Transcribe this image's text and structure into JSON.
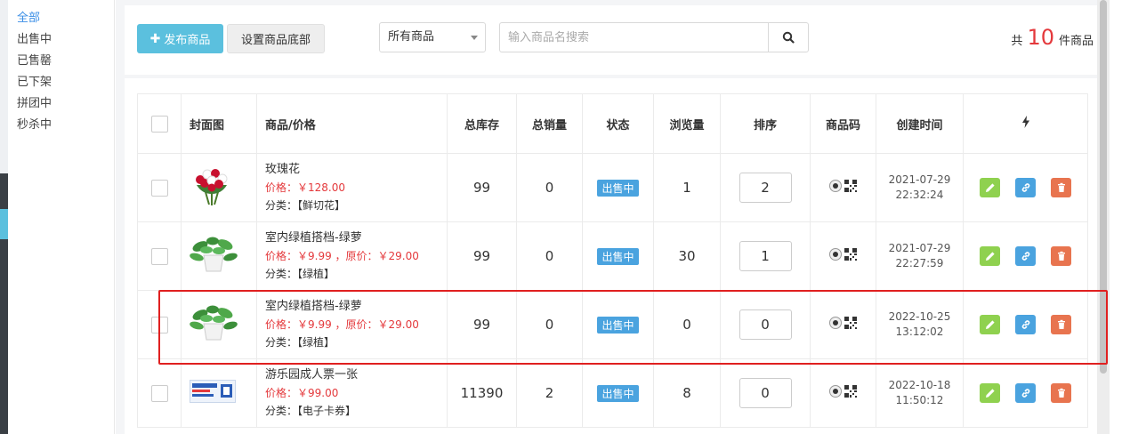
{
  "subnav": [
    "全部",
    "出售中",
    "已售罄",
    "已下架",
    "拼团中",
    "秒杀中"
  ],
  "toolbar": {
    "publish_label": "发布商品",
    "footer_label": "设置商品底部",
    "select_value": "所有商品",
    "search_placeholder": "输入商品名搜索",
    "total_prefix": "共",
    "total_count": "10",
    "total_suffix": "件商品"
  },
  "table": {
    "headers": [
      "封面图",
      "商品/价格",
      "总库存",
      "总销量",
      "状态",
      "浏览量",
      "排序",
      "商品码",
      "创建时间"
    ],
    "rows": [
      {
        "name": "玫瑰花",
        "price": "价格：￥128.00",
        "category": "分类：【鲜切花】",
        "stock": "99",
        "sales": "0",
        "status": "出售中",
        "views": "1",
        "sort": "2",
        "created_date": "2021-07-29",
        "created_time": "22:32:24",
        "thumb": "rose-bouquet"
      },
      {
        "name": "室内绿植搭档-绿萝",
        "price": "价格：￥9.99 ，原价：￥29.00",
        "category": "分类：【绿植】",
        "stock": "99",
        "sales": "0",
        "status": "出售中",
        "views": "30",
        "sort": "1",
        "created_date": "2021-07-29",
        "created_time": "22:27:59",
        "thumb": "potted-plant"
      },
      {
        "name": "室内绿植搭档-绿萝",
        "price": "价格：￥9.99 ，原价：￥29.00",
        "category": "分类：【绿植】",
        "stock": "99",
        "sales": "0",
        "status": "出售中",
        "views": "0",
        "sort": "0",
        "created_date": "2022-10-25",
        "created_time": "13:12:02",
        "thumb": "potted-plant"
      },
      {
        "name": "游乐园成人票一张",
        "price": "价格：￥99.00",
        "category": "分类：【电子卡券】",
        "stock": "11390",
        "sales": "2",
        "status": "出售中",
        "views": "8",
        "sort": "0",
        "created_date": "2022-10-18",
        "created_time": "11:50:12",
        "thumb": "ticket-card"
      }
    ]
  },
  "colors": {
    "accent": "#5bc0de",
    "price": "#e4393c",
    "status_badge": "#4aa3df",
    "highlight_box": "#e02020"
  }
}
